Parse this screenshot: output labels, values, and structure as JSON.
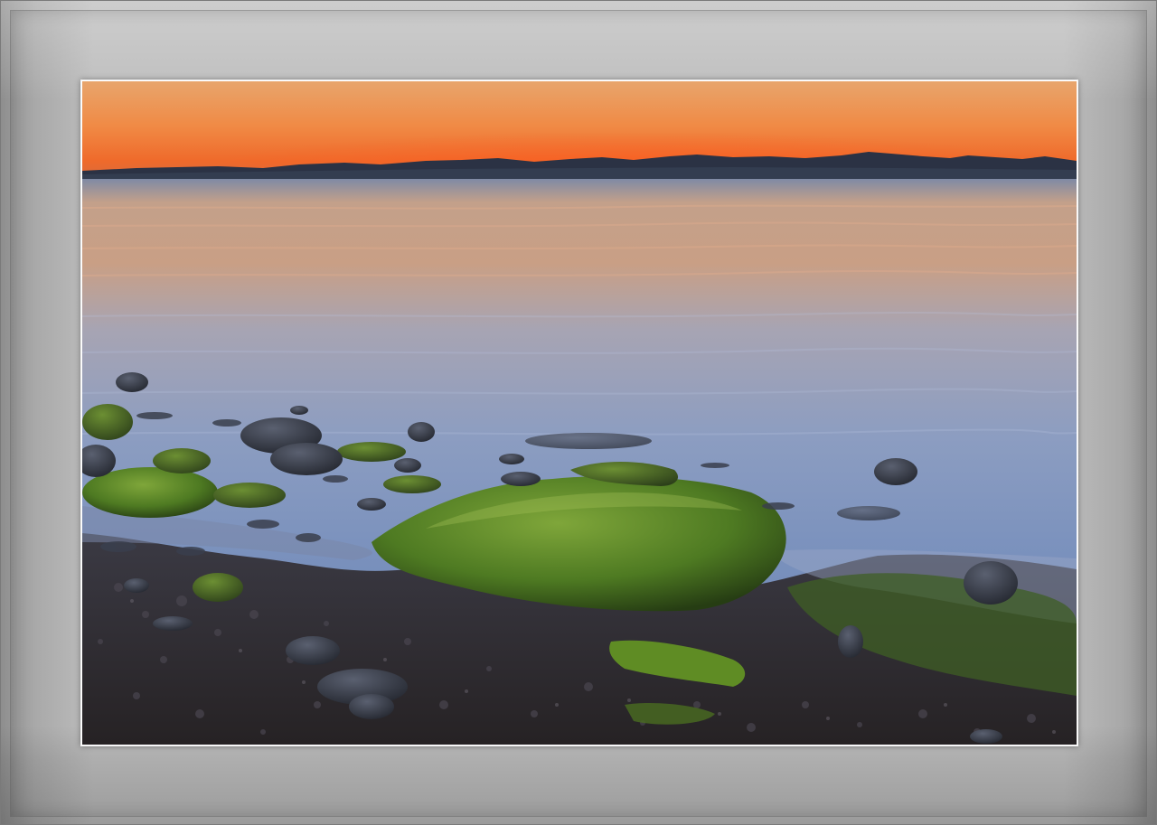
{
  "image": {
    "subject": "sunset-seascape",
    "colors": {
      "sky_top": "#e9955a",
      "sky_glow": "#f26a2a",
      "mountains": "#2a3140",
      "water_far": "#c9a78f",
      "water_mid": "#8f9ab8",
      "water_near": "#6f86b0",
      "moss": "#4f7a1e",
      "shore": "#2f2b2c"
    }
  }
}
